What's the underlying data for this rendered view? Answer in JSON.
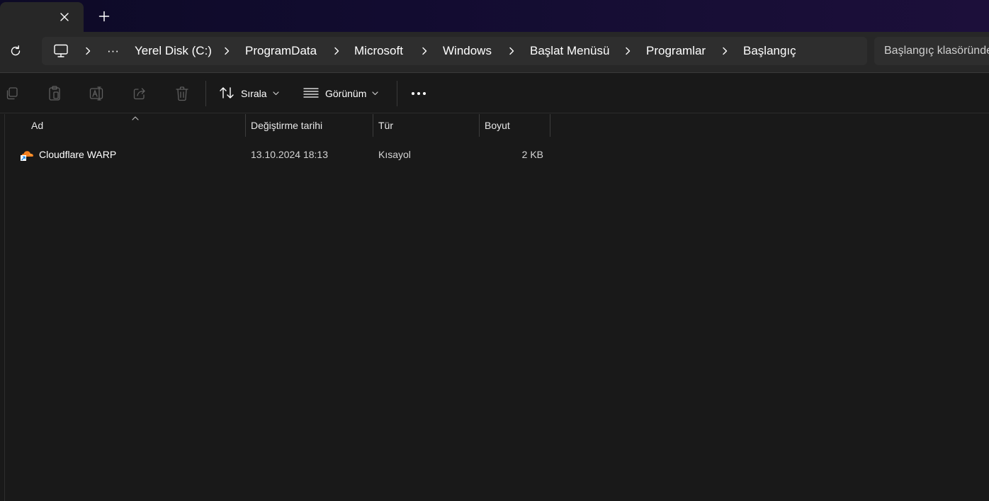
{
  "tabbar": {
    "close_icon": "close-icon",
    "new_tab_icon": "plus-icon"
  },
  "nav": {
    "refresh_icon": "refresh-icon",
    "breadcrumb": {
      "root_icon": "computer-icon",
      "overflow": "···",
      "items": [
        "Yerel Disk (C:)",
        "ProgramData",
        "Microsoft",
        "Windows",
        "Başlat Menüsü",
        "Programlar",
        "Başlangıç"
      ]
    },
    "search_placeholder": "Başlangıç klasöründe ara"
  },
  "toolbar": {
    "disabled_icons": [
      "copy-icon",
      "paste-icon",
      "rename-icon",
      "share-icon",
      "delete-icon"
    ],
    "sort_label": "Sırala",
    "view_label": "Görünüm",
    "more_icon": "more-icon"
  },
  "columns": {
    "name": "Ad",
    "modified": "Değiştirme tarihi",
    "type": "Tür",
    "size": "Boyut"
  },
  "files": [
    {
      "name": "Cloudflare WARP",
      "modified": "13.10.2024 18:13",
      "type": "Kısayol",
      "size": "2 KB",
      "icon": "cloudflare-shortcut-icon"
    }
  ],
  "colors": {
    "accent_orange": "#f38020",
    "shortcut_blue": "#1e88e5"
  }
}
